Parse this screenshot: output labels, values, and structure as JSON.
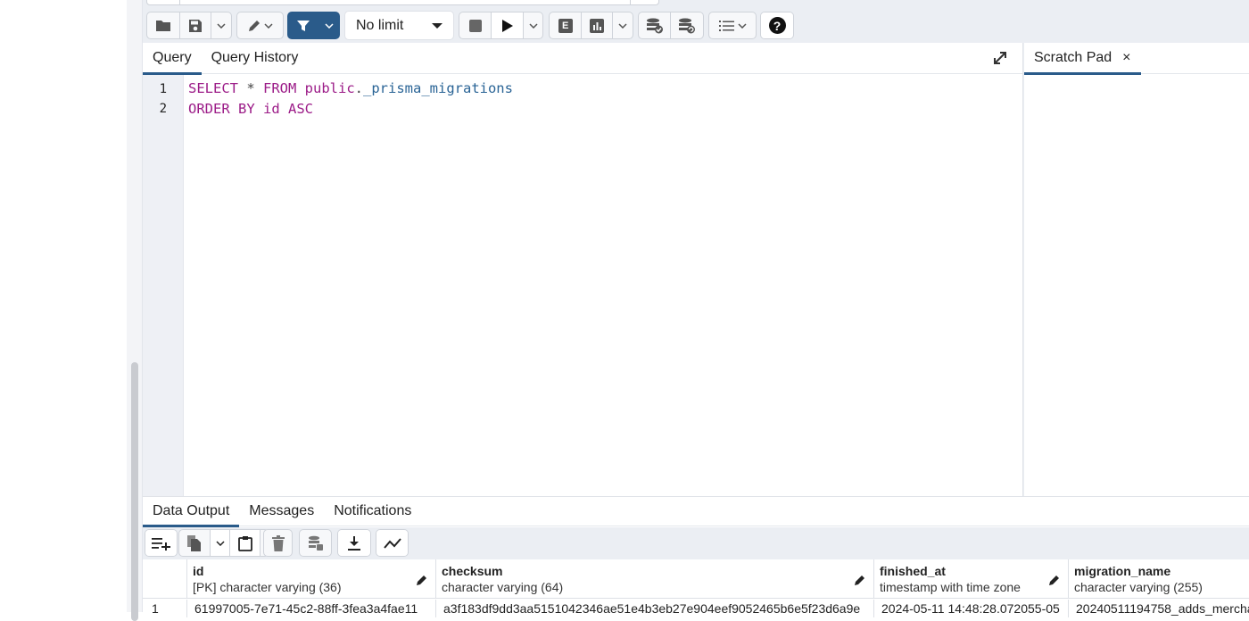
{
  "toolbar": {
    "open_file": "folder-icon",
    "save": "save-icon",
    "edit": "pencil-icon",
    "filter": "filter-icon",
    "limit_value": "No limit",
    "stop": "stop-icon",
    "execute": "play-icon",
    "explain": "E",
    "explain_analyze": "bar-chart-icon",
    "commit": "database-check-icon",
    "rollback": "database-undo-icon",
    "macros": "list-numbered-icon",
    "help": "?"
  },
  "query_tabs": [
    {
      "label": "Query",
      "active": true
    },
    {
      "label": "Query History",
      "active": false
    }
  ],
  "editor": {
    "lines": [
      {
        "num": "1"
      },
      {
        "num": "2"
      }
    ],
    "line1": {
      "kw1": "SELECT",
      "star": " * ",
      "kw2": "FROM",
      "schema": " public",
      "dot": ".",
      "table": "_prisma_migrations"
    },
    "line2": {
      "kw1": "ORDER BY",
      "col": " id ",
      "kw2": "ASC"
    }
  },
  "scratch_pad": {
    "label": "Scratch Pad",
    "close": "×"
  },
  "output_tabs": [
    {
      "label": "Data Output",
      "active": true
    },
    {
      "label": "Messages",
      "active": false
    },
    {
      "label": "Notifications",
      "active": false
    }
  ],
  "grid": {
    "columns": [
      {
        "name": "id",
        "type": "[PK] character varying (36)"
      },
      {
        "name": "checksum",
        "type": "character varying (64)"
      },
      {
        "name": "finished_at",
        "type": "timestamp with time zone"
      },
      {
        "name": "migration_name",
        "type": "character varying (255)"
      }
    ],
    "rows": [
      {
        "num": "1",
        "id": "61997005-7e71-45c2-88ff-3fea3a4fae11",
        "checksum": "a3f183df9dd3aa5151042346ae51e4b3eb27e904eef9052465b6e5f23d6a9e",
        "finished_at": "2024-05-11 14:48:28.072055-05",
        "migration_name": "20240511194758_adds_mercha"
      }
    ]
  },
  "colors": {
    "accent": "#2a5b8a",
    "keyword": "#9c1c88",
    "identifier": "#2a6496"
  }
}
